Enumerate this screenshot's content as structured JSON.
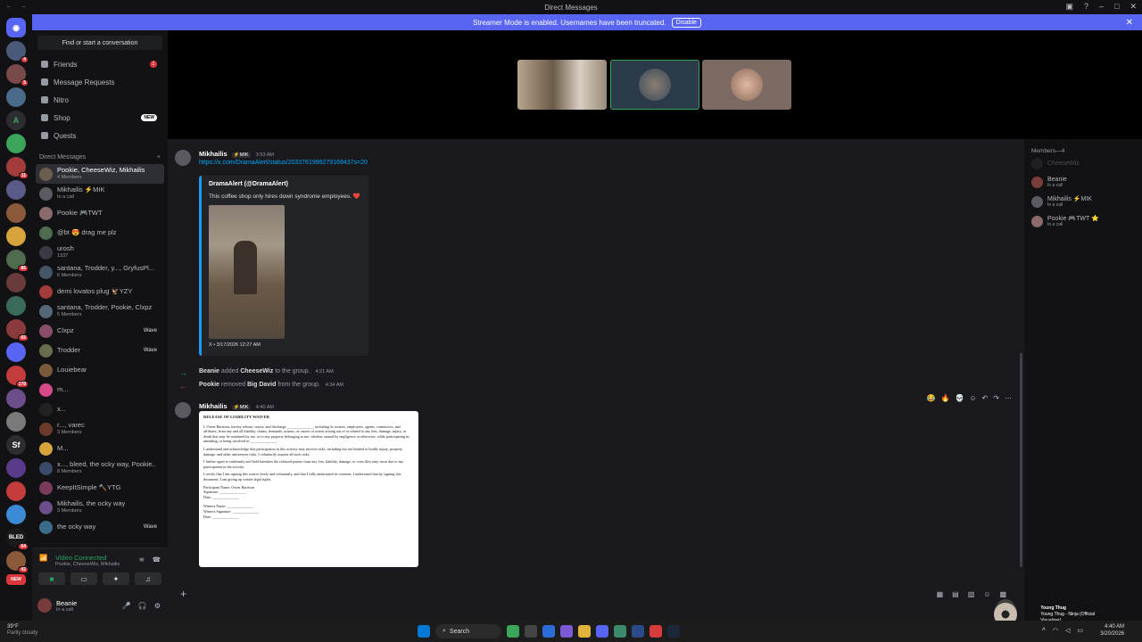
{
  "window": {
    "title": "Direct Messages"
  },
  "banner": {
    "text": "Streamer Mode is enabled. Usernames have been truncated.",
    "button": "Disable"
  },
  "sidebar": {
    "search_placeholder": "Find or start a conversation",
    "nav": [
      {
        "label": "Friends",
        "badge": "1"
      },
      {
        "label": "Message Requests"
      },
      {
        "label": "Nitro"
      },
      {
        "label": "Shop",
        "badge_new": "NEW"
      },
      {
        "label": "Quests"
      }
    ],
    "dm_header": "Direct Messages",
    "dms": [
      {
        "name": "Pookie, CheeseWiz, Mikhailis",
        "sub": "4 Members",
        "color": "#6b5e4e"
      },
      {
        "name": "Mikhailis ⚡MIK",
        "sub": "In a call",
        "color": "#5a5a62"
      },
      {
        "name": "Pookie 🎮TWT",
        "sub": "",
        "color": "#8a6a6a"
      },
      {
        "name": "@bt 😍 drag me plz",
        "sub": "",
        "color": "#4e6b4e"
      },
      {
        "name": "urosh",
        "sub": "1337",
        "color": "#3a3a44"
      },
      {
        "name": "santana, Trodder, y..., GryfusPl...",
        "sub": "6 Members",
        "color": "#445566"
      },
      {
        "name": "demi lovatos plug 🦅YZY",
        "sub": "",
        "color": "#a33b3b"
      },
      {
        "name": "santana, Trodder, Pookie, Clxpz",
        "sub": "5 Members",
        "color": "#556677"
      },
      {
        "name": "Clxpz",
        "sub": "",
        "color": "#8a4e6b",
        "wave": "Wave"
      },
      {
        "name": "Trodder",
        "sub": "",
        "color": "#6b6b4e",
        "wave": "Wave"
      },
      {
        "name": "Louiebear",
        "sub": "",
        "color": "#7a5a3a"
      },
      {
        "name": "m...",
        "sub": "",
        "color": "#d64a8a"
      },
      {
        "name": "x...",
        "sub": "",
        "color": "#222"
      },
      {
        "name": "r..., varec",
        "sub": "3 Members",
        "color": "#6b3a2a"
      },
      {
        "name": "M...",
        "sub": "",
        "color": "#d6a43a"
      },
      {
        "name": "x..., bleed, the ocky way, Pookie...",
        "sub": "8 Members",
        "color": "#3a4a6b"
      },
      {
        "name": "KeepItSimple 🔨YTG",
        "sub": "",
        "color": "#7a3a5a"
      },
      {
        "name": "Mikhailis, the ocky way",
        "sub": "3 Members",
        "color": "#6b4e8a"
      },
      {
        "name": "the ocky way",
        "sub": "",
        "color": "#3a6b8a",
        "wave": "Wave"
      }
    ],
    "voice": {
      "status": "Video Connected",
      "channel": "Pookie, CheeseWiz, Mikhailis"
    },
    "user": {
      "name": "Beanie",
      "status": "In a call"
    }
  },
  "guild_badges": [
    "",
    "4",
    "5",
    "",
    "",
    "",
    "11",
    "",
    "",
    "",
    "86",
    "",
    "",
    "65",
    "",
    "178",
    "",
    "",
    "",
    "",
    "",
    "",
    "64",
    "42",
    "",
    "",
    "",
    "170",
    "NEW"
  ],
  "messages": {
    "m1": {
      "author": "Mikhailis",
      "tag": "⚡MIK",
      "time": "3:53 AM",
      "link": "https://x.com/DramaAlert/status/2033761999279169437s=20",
      "embed": {
        "author": "DramaAlert (@DramaAlert)",
        "text": "This coffee shop only hires down syndrome employees. ❤️",
        "footer": "X • 3/17/2026 12:27 AM"
      }
    },
    "sys1": {
      "actor": "Beanie",
      "verb": "added",
      "target": "CheeseWiz",
      "rest": "to the group.",
      "time": "4:21 AM"
    },
    "sys2": {
      "actor": "Pookie",
      "verb": "removed",
      "target": "Big David",
      "rest": "from the group.",
      "time": "4:34 AM"
    },
    "m2": {
      "author": "Mikhailis",
      "tag": "⚡MIK",
      "time": "4:40 AM",
      "doc": {
        "title": "RELEASE OF LIABILITY WAIVER",
        "p1": "I, Owen Harrison, hereby release, waive, and discharge ______________, including its owners, employees, agents, contractors, and affiliates, from any and all liability, claims, demands, actions, or causes of action arising out of or related to any loss, damage, injury, or death that may be sustained by me, or to any property belonging to me, whether caused by negligence or otherwise, while participating in, attending, or being involved in ______________.",
        "p2": "I understand and acknowledge that participation in this activity may involve risks, including but not limited to bodily injury, property damage, and other unforeseen risks. I voluntarily assume all such risks.",
        "p3": "I further agree to indemnify and hold harmless the released parties from any loss, liability, damage, or costs they may incur due to my participation in the activity.",
        "p4": "I certify that I am signing this waiver freely and voluntarily, and that I fully understand its contents. I understand that by signing this document, I am giving up certain legal rights.",
        "participant": "Participant Name: Owen Harrison",
        "signature": "Signature: ______________",
        "date": "Date: ______________",
        "witness": "Witness Name: ______________",
        "wsig": "Witness Signature: ______________",
        "wdate": "Date: ______________"
      }
    }
  },
  "members": {
    "header": "Members—4",
    "list": [
      {
        "name": "CheeseWiz",
        "sub": "",
        "color": "#3a3a44"
      },
      {
        "name": "Beanie",
        "sub": "In a call",
        "color": "#7a3b3b"
      },
      {
        "name": "Mikhailis ⚡MIK",
        "sub": "In a call",
        "color": "#5a5a62"
      },
      {
        "name": "Pookie 🎮TWT ⭐",
        "sub": "In a call",
        "color": "#8a6a6a"
      }
    ]
  },
  "taskbar": {
    "weather_temp": "39°F",
    "weather_desc": "Partly cloudy",
    "search": "Search",
    "time": "4:40 AM",
    "date": "3/20/2026",
    "nowplaying_artist": "Young Thug",
    "nowplaying_track": "Young Thug - Ninja (Official Visualizer)"
  }
}
